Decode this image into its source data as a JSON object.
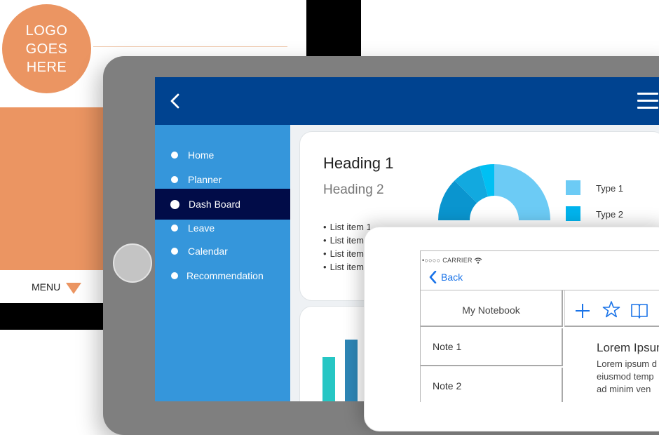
{
  "logo": {
    "lines": [
      "LOGO",
      "GOES",
      "HERE"
    ]
  },
  "back_mockup": {
    "menu_label": "MENU"
  },
  "sidebar": {
    "items": [
      {
        "label": "Home"
      },
      {
        "label": "Planner"
      },
      {
        "label": "Dash Board",
        "active": true
      },
      {
        "label": "Leave"
      },
      {
        "label": "Calendar"
      },
      {
        "label": "Recommendation"
      }
    ]
  },
  "dashboard": {
    "heading1": "Heading 1",
    "heading2": "Heading 2",
    "list_items": [
      "List item 1",
      "List item",
      "List item",
      "List item"
    ],
    "legend": [
      {
        "label": "Type 1",
        "color": "#6ccbf5"
      },
      {
        "label": "Type 2",
        "color": "#00b4ee"
      }
    ]
  },
  "colors": {
    "accent_orange": "#eb9562",
    "header_blue": "#004390",
    "sidebar_blue": "#3596db",
    "active_navy": "#010c48",
    "ios_blue": "#1a73e8"
  },
  "phone": {
    "status": "•○○○○ CARRIER",
    "back_label": "Back",
    "notebook_title": "My Notebook",
    "notes": [
      "Note 1",
      "Note 2"
    ],
    "content_title": "Lorem Ipsum",
    "content_lines": [
      "Lorem ipsum d",
      "eiusmod temp",
      "ad minim ven",
      "..."
    ],
    "toolbar_icons": [
      "plus-icon",
      "star-icon",
      "book-icon"
    ]
  }
}
